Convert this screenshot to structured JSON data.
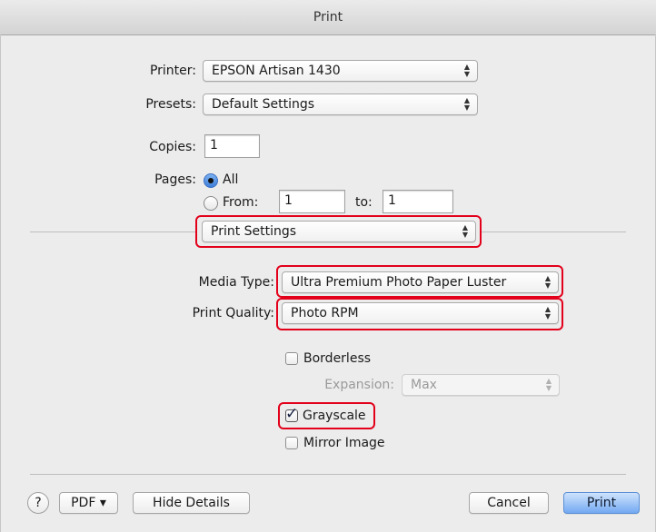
{
  "window": {
    "title": "Print"
  },
  "printer": {
    "label": "Printer:",
    "value": "EPSON Artisan 1430"
  },
  "presets": {
    "label": "Presets:",
    "value": "Default Settings"
  },
  "copies": {
    "label": "Copies:",
    "value": "1"
  },
  "pages": {
    "label": "Pages:",
    "all_label": "All",
    "from_label": "From:",
    "from_value": "1",
    "to_label": "to:",
    "to_value": "1",
    "selected": "All"
  },
  "section_popup": {
    "value": "Print Settings"
  },
  "media_type": {
    "label": "Media Type:",
    "value": "Ultra Premium Photo Paper Luster"
  },
  "print_quality": {
    "label": "Print Quality:",
    "value": "Photo RPM"
  },
  "options": {
    "borderless": {
      "label": "Borderless",
      "checked": false
    },
    "expansion": {
      "label": "Expansion:",
      "value": "Max",
      "enabled": false
    },
    "grayscale": {
      "label": "Grayscale",
      "checked": true
    },
    "mirror_image": {
      "label": "Mirror Image",
      "checked": false
    }
  },
  "footer": {
    "help": "?",
    "pdf": "PDF ▾",
    "hide_details": "Hide Details",
    "cancel": "Cancel",
    "print": "Print"
  },
  "glyphs": {
    "popup_arrows": "⌃⌄",
    "checkmark": "✓"
  },
  "colors": {
    "highlight": "#e3001b",
    "default_button": "#73a9f2",
    "radio_selected": "#3f80da"
  }
}
